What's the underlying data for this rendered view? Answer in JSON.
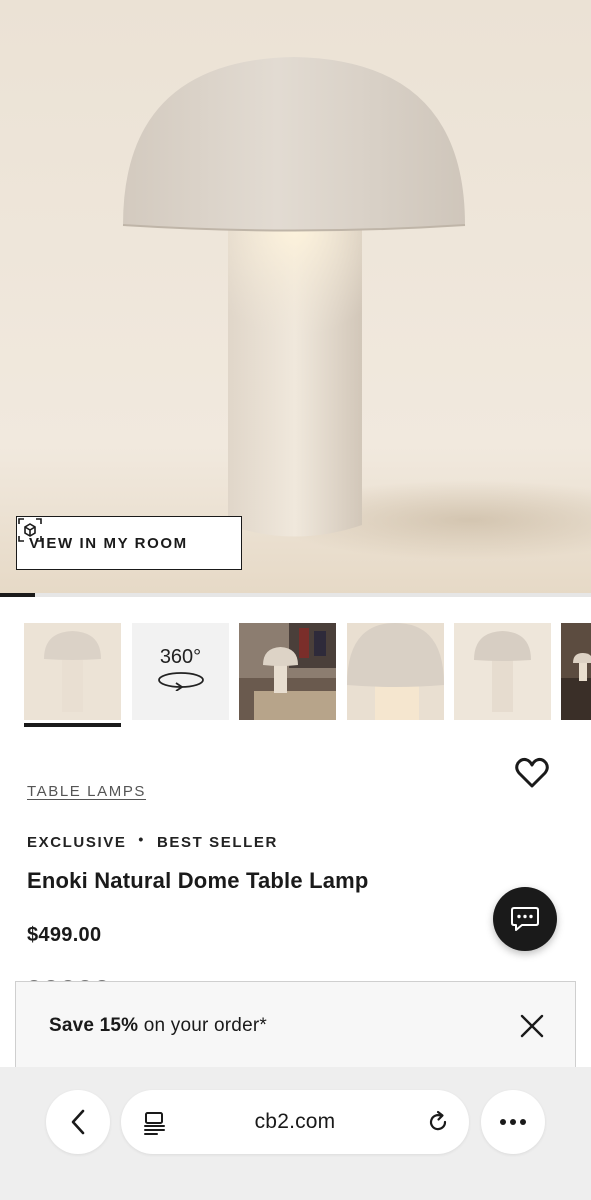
{
  "hero": {
    "view_in_room_label": "VIEW IN MY ROOM",
    "carousel_progress_fraction": 0.06
  },
  "thumbnails": {
    "items": [
      {
        "name": "thumb-lamp-front",
        "selected": true
      },
      {
        "name": "thumb-360-view",
        "label": "360°",
        "selected": false
      },
      {
        "name": "thumb-lifestyle-room",
        "selected": false
      },
      {
        "name": "thumb-lamp-closeup",
        "selected": false
      },
      {
        "name": "thumb-lamp-studio",
        "selected": false
      },
      {
        "name": "thumb-lamp-partial",
        "selected": false
      }
    ]
  },
  "product": {
    "category": "TABLE LAMPS",
    "badge_exclusive": "EXCLUSIVE",
    "badge_separator": "•",
    "badge_best_seller": "BEST SELLER",
    "title": "Enoki Natural Dome Table Lamp",
    "price": "$499.00"
  },
  "promo": {
    "strong": "Save 15%",
    "rest": " on your order*"
  },
  "browser": {
    "domain": "cb2.com"
  },
  "colors": {
    "accent": "#1a1a1a",
    "hero_bg": "#ede4d7",
    "lamp": "#dcd3c8",
    "browser_bar": "#eeeeee"
  },
  "icons": [
    "ar-cube-icon",
    "heart-icon",
    "chat-icon",
    "close-icon",
    "back-icon",
    "reader-icon",
    "reload-icon",
    "more-icon",
    "rotate-360-icon"
  ]
}
